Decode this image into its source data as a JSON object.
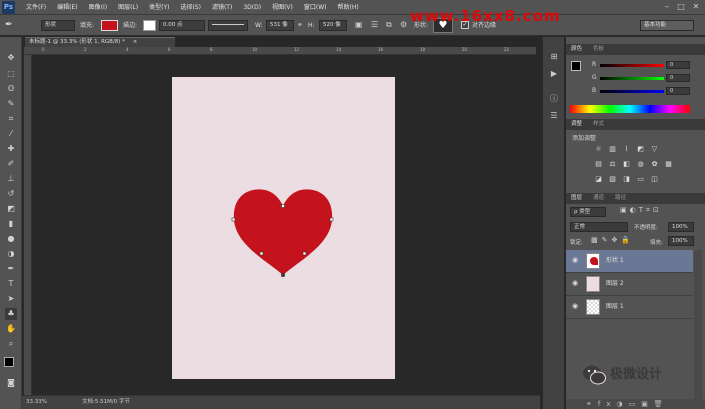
{
  "app": {
    "logo": "Ps"
  },
  "menu": [
    "文件(F)",
    "编辑(E)",
    "图像(I)",
    "图层(L)",
    "类型(Y)",
    "选择(S)",
    "滤镜(T)",
    "3D(D)",
    "视图(V)",
    "窗口(W)",
    "帮助(H)"
  ],
  "window_controls": {
    "minimize": "–",
    "maximize": "□",
    "close": "✕"
  },
  "options": {
    "mode": "形状",
    "fill_label": "填充:",
    "stroke_label": "描边:",
    "stroke_width": "0.00 点",
    "w_label": "W:",
    "w_value": "531 像",
    "h_label": "H:",
    "h_value": "520 像",
    "shape_label": "形状:",
    "align_label": "对齐边缘",
    "workspace": "基本功能",
    "fill_color": "#c4131c"
  },
  "watermark_top": "www.16xx8.com",
  "document": {
    "tab": "未标题-1 @ 33.3% (形状 1, RGB/8) *",
    "close": "×"
  },
  "ruler_top": [
    "0",
    "2",
    "4",
    "6",
    "8",
    "10",
    "12",
    "14",
    "16",
    "18",
    "20",
    "22"
  ],
  "status": {
    "zoom": "33.33%",
    "doc": "文档:5.51M/0 字节"
  },
  "panels": {
    "color": {
      "tabs": [
        "颜色",
        "色板"
      ],
      "channels": [
        "R",
        "G",
        "B"
      ],
      "values": [
        "0",
        "0",
        "0"
      ]
    },
    "adjustments": {
      "tabs": [
        "调整",
        "样式"
      ],
      "title": "添加调整"
    },
    "layers": {
      "tabs": [
        "图层",
        "通道",
        "路径"
      ],
      "filter": "ρ 类型",
      "blend": "正常",
      "opacity_label": "不透明度:",
      "opacity": "100%",
      "lock_label": "锁定:",
      "fill_label": "填充:",
      "fill": "100%",
      "items": [
        {
          "name": "形状 1",
          "selected": true
        },
        {
          "name": "图层 2",
          "selected": false
        },
        {
          "name": "图层 1",
          "selected": false
        }
      ]
    }
  },
  "brand_watermark": "极微设计",
  "heart_color": "#c4131c"
}
